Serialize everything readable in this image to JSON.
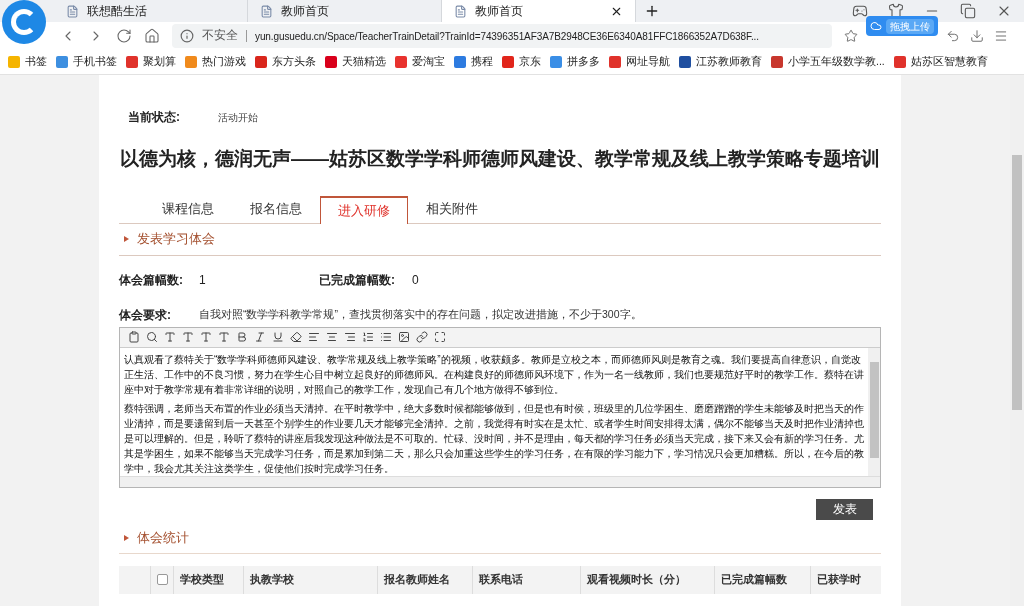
{
  "browser": {
    "tabs": [
      {
        "title": "联想酷生活",
        "selected": false
      },
      {
        "title": "教师首页",
        "selected": false
      },
      {
        "title": "教师首页",
        "selected": true
      }
    ],
    "security_label": "不安全",
    "url": "yun.gusuedu.cn/Space/TeacherTrainDetail?TrainId=74396351AF3A7B2948CE36E6340A81FFC1866352A7D638F...",
    "upload_button": "拖拽上传",
    "bookmarks": [
      {
        "label": "书签",
        "color": "#f5b400"
      },
      {
        "label": "手机书签",
        "color": "#3d8fe0"
      },
      {
        "label": "聚划算",
        "color": "#e0322b"
      },
      {
        "label": "热门游戏",
        "color": "#f08a1c"
      },
      {
        "label": "东方头条",
        "color": "#d9261c"
      },
      {
        "label": "天猫精选",
        "color": "#d9001b"
      },
      {
        "label": "爱淘宝",
        "color": "#e8322e"
      },
      {
        "label": "携程",
        "color": "#2d7be0"
      },
      {
        "label": "京东",
        "color": "#e1251b"
      },
      {
        "label": "拼多多",
        "color": "#3a8ee6"
      },
      {
        "label": "网址导航",
        "color": "#e0322b"
      },
      {
        "label": "江苏教师教育",
        "color": "#1f4fa0"
      },
      {
        "label": "小学五年级数学教...",
        "color": "#c8372d"
      },
      {
        "label": "姑苏区智慧教育",
        "color": "#e0322b"
      }
    ]
  },
  "page": {
    "status_label": "当前状态:",
    "status_value": "活动开始",
    "title": "以德为核，德润无声——姑苏区数学学科师德师风建设、教学常规及线上教学策略专题培训",
    "tabs": [
      {
        "label": "课程信息",
        "selected": false
      },
      {
        "label": "报名信息",
        "selected": false
      },
      {
        "label": "进入研修",
        "selected": true
      },
      {
        "label": "相关附件",
        "selected": false
      }
    ],
    "section_1": "发表学习体会",
    "count_label": "体会篇幅数:",
    "count_value": "1",
    "done_label": "已完成篇幅数:",
    "done_value": "0",
    "requirement_label": "体会要求:",
    "requirement_text": "自我对照“数学学科教学常规”，查找贯彻落实中的存在问题，拟定改进措施，不少于300字。",
    "editor_paragraphs": [
      "认真观看了蔡特关于“数学学科师德师风建设、教学常规及线上教学策略”的视频，收获颇多。教师是立校之本，而师德师风则是教育之魂。我们要提高自律意识，自觉改正生活、工作中的不良习惯，努力在学生心目中树立起良好的师德师风。在构建良好的师德师风环境下，作为一名一线教师，我们也要规范好平时的教学工作。蔡特在讲座中对于教学常规有着非常详细的说明，对照自己的教学工作，发现自己有几个地方做得不够到位。",
      "蔡特强调，老师当天布置的作业必须当天清掉。在平时教学中，绝大多数时候都能够做到，但是也有时侯，班级里的几位学困生、磨磨蹭蹭的学生未能够及时把当天的作业清掉，而是要遗留到后一天甚至个别学生的作业要几天才能够完全清掉。之前，我觉得有时实在是太忙、或者学生时间安排得太满，偶尔不能够当天及时把作业清掉也是可以理解的。但是，聆听了蔡特的讲座后我发现这种做法是不可取的。忙碌、没时间，并不是理由，每天都的学习任务必须当天完成，接下来又会有新的学习任务。尤其是学困生，如果不能够当天完成学习任务，而是累加到第二天，那么只会加重这些学生的学习任务，在有限的学习能力下，学习情况只会更加糟糕。所以，在今后的教学中，我会尤其关注这类学生，促使他们按时完成学习任务。"
    ],
    "submit_button": "发表",
    "section_2": "体会统计",
    "table": {
      "select_all_checked": false,
      "columns": [
        "学校类型",
        "执教学校",
        "报名教师姓名",
        "联系电话",
        "观看视频时长（分）",
        "已完成篇幅数",
        "已获学时"
      ]
    }
  }
}
